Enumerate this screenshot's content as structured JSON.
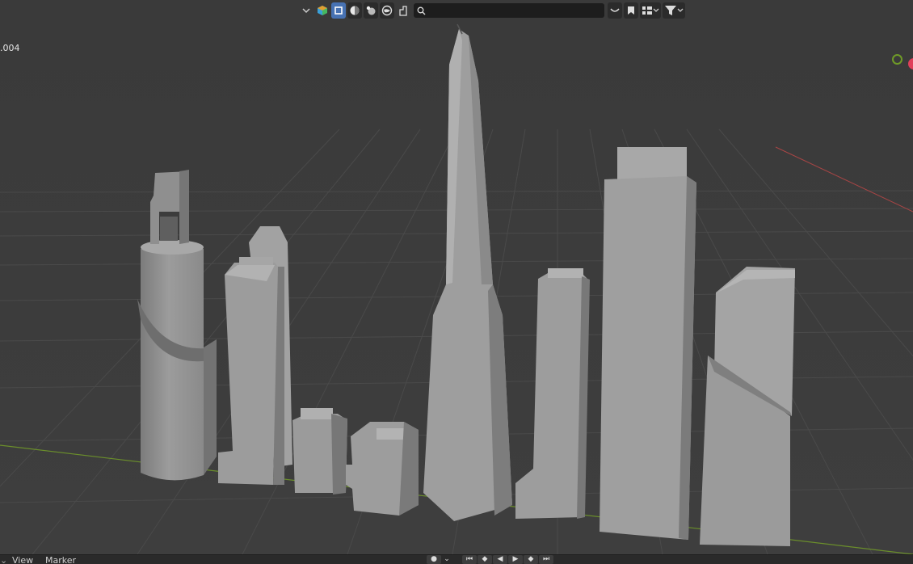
{
  "viewport": {
    "object_label": ".004",
    "search": {
      "value": "",
      "placeholder": ""
    }
  },
  "header_icons": [
    {
      "icon": "chevron-down-icon"
    },
    {
      "icon": "object-type-colorful-icon"
    },
    {
      "icon": "select-box-icon"
    },
    {
      "icon": "viewport-shading-icon"
    },
    {
      "icon": "render-shading-icon"
    },
    {
      "icon": "world-shading-icon"
    },
    {
      "icon": "object-gizmo-icon"
    }
  ],
  "timeline": {
    "menus": [
      "View",
      "Marker"
    ]
  },
  "colors": {
    "background": "#3c3c3c",
    "grid": "#4a4a4a",
    "x_axis": "#b04848",
    "y_axis": "#6b8f2b",
    "active_button": "#4772b3",
    "building_light": "#9a9a9a",
    "building_dark": "#7a7a7a"
  }
}
